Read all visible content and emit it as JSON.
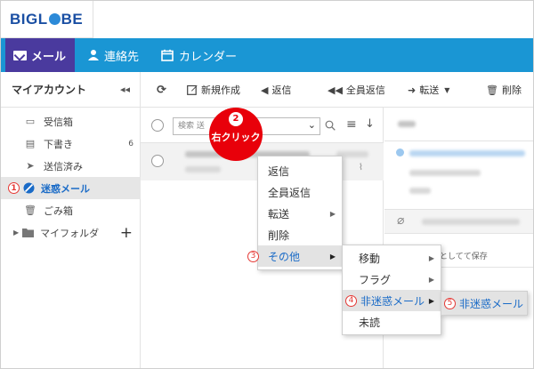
{
  "logo": {
    "left": "BIGL",
    "right": "BE"
  },
  "nav": {
    "mail": "メール",
    "contacts": "連絡先",
    "calendar": "カレンダー"
  },
  "sidebar": {
    "title": "マイアカウント",
    "collapse_glyph": "◂◂",
    "items": [
      {
        "label": "受信箱",
        "icon": "inbox-icon"
      },
      {
        "label": "下書き",
        "icon": "draft-icon",
        "count": "6"
      },
      {
        "label": "送信済み",
        "icon": "sent-icon"
      },
      {
        "label": "迷惑メール",
        "icon": "spam-icon",
        "step": "1"
      },
      {
        "label": "ごみ箱",
        "icon": "trash-icon"
      },
      {
        "label": "マイフォルダ",
        "icon": "folder-icon",
        "add": "+"
      }
    ]
  },
  "toolbar": {
    "refresh": "⟳",
    "compose": "新規作成",
    "reply": "返信",
    "reply_all": "全員返信",
    "forward": "転送",
    "delete": "削除"
  },
  "list": {
    "search_placeholder": "検索 送"
  },
  "callout": {
    "number": "2",
    "label": "右クリック"
  },
  "context_menu": {
    "items": [
      "返信",
      "全員返信",
      "転送",
      "削除"
    ],
    "other": "その他",
    "other_step": "3"
  },
  "submenu": {
    "move": "移動",
    "flag": "フラグ",
    "not_spam": "非迷惑メール",
    "not_spam_step": "4",
    "unread": "未読"
  },
  "submenu2": {
    "label": "非迷惑メール",
    "step": "5"
  },
  "preview": {
    "attachment_text": "としてて保存"
  }
}
